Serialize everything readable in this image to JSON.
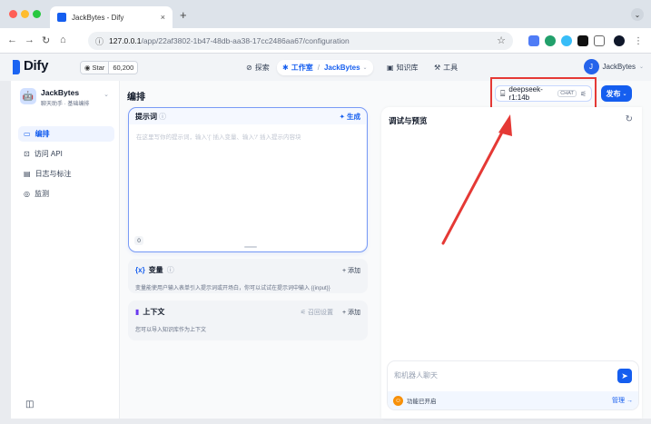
{
  "browser": {
    "tab_title": "JackBytes - Dify",
    "tab_close": "×",
    "new_tab": "+",
    "tab_menu": "⌄",
    "nav_back": "←",
    "nav_forward": "→",
    "nav_reload": "↻",
    "nav_home": "⌂",
    "url_host": "127.0.0.1",
    "url_path": "/app/22af3802-1b47-48db-aa38-17cc2486aa67/configuration",
    "bookmark_star": "☆"
  },
  "header": {
    "logo": "Dify",
    "github_star_label": "Star",
    "github_star_count": "60,200",
    "nav": {
      "explore": "探索",
      "studio": "工作室",
      "studio_app": "JackBytes",
      "knowledge": "知识库",
      "tools": "工具"
    },
    "user_initial": "J",
    "user_name": "JackBytes"
  },
  "sidebar": {
    "app_name": "JackBytes",
    "app_tags": "聊天助手 · 基础编排",
    "items": [
      {
        "label": "编排",
        "icon": "layout-icon",
        "glyph": "▭",
        "active": true
      },
      {
        "label": "访问 API",
        "icon": "terminal-icon",
        "glyph": "⊡",
        "active": false
      },
      {
        "label": "日志与标注",
        "icon": "file-list-icon",
        "glyph": "▤",
        "active": false
      },
      {
        "label": "监测",
        "icon": "monitor-icon",
        "glyph": "◎",
        "active": false
      }
    ],
    "collapse_glyph": "◫"
  },
  "main": {
    "title": "编排",
    "model": {
      "name": "deepseek-r1:14b",
      "mode": "CHAT"
    },
    "publish_label": "发布",
    "prompt": {
      "label": "提示词",
      "generate_label": "生成",
      "placeholder": "在这里写你的提示词，输入'{' 插入变量、输入'/' 插入提示内容块",
      "char_count": "0"
    },
    "variables": {
      "title": "变量",
      "add_label": "+ 添加",
      "description": "变量能使用户输入表单引入提示词或开场白，你可以试试在提示词中输入 {{input}}"
    },
    "context": {
      "title": "上下文",
      "recall_label": "召回设置",
      "add_label": "+ 添加",
      "description": "您可以导入知识库作为上下文"
    }
  },
  "debug": {
    "title": "调试与预览",
    "chat_placeholder": "和机器人聊天",
    "feature_label": "功能已开启",
    "manage_label": "管理"
  },
  "colors": {
    "accent": "#155eef",
    "annotation": "#e53935"
  }
}
